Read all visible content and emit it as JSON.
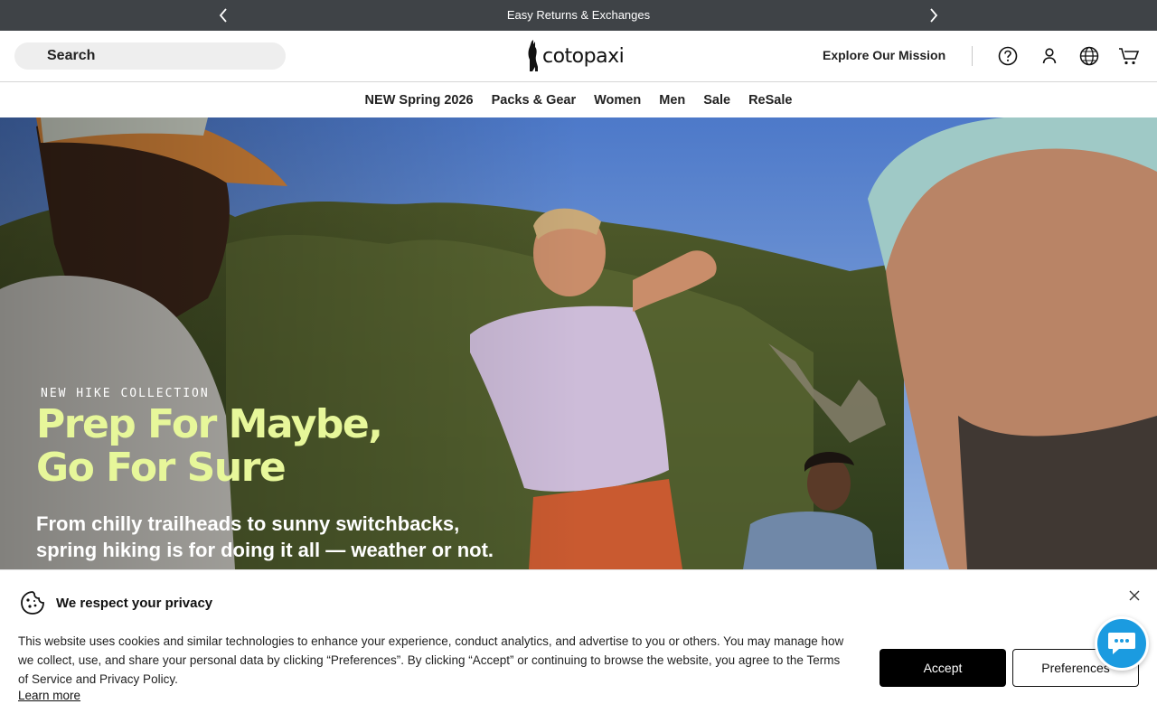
{
  "announcement": {
    "message": "Easy Returns & Exchanges",
    "prev_icon": "chevron-left-icon",
    "next_icon": "chevron-right-icon"
  },
  "header": {
    "search_label": "Search",
    "logo_text": "cotopaxi",
    "mission_link": "Explore Our Mission",
    "icons": [
      "help-icon",
      "account-icon",
      "globe-icon",
      "cart-icon"
    ]
  },
  "nav": {
    "items": [
      {
        "label": "NEW Spring 2026"
      },
      {
        "label": "Packs & Gear"
      },
      {
        "label": "Women"
      },
      {
        "label": "Men"
      },
      {
        "label": "Sale"
      },
      {
        "label": "ReSale"
      }
    ]
  },
  "hero": {
    "eyebrow": "NEW HIKE COLLECTION",
    "headline_line1": "Prep For Maybe,",
    "headline_line2": "Go For Sure",
    "subtext_line1": "From chilly trailheads to sunny switchbacks,",
    "subtext_line2": "spring hiking is for doing it all — weather or not."
  },
  "cookie_banner": {
    "title": "We respect your privacy",
    "body": "This website uses cookies and similar technologies to enhance your experience, conduct analytics, and advertise to you or others. You may manage how we collect, use, and share your personal data by clicking “Preferences”. By clicking “Accept” or continuing to browse the website, you agree to the Terms of Service and Privacy Policy.",
    "learn_more": "Learn more",
    "accept_label": "Accept",
    "preferences_label": "Preferences"
  },
  "colors": {
    "announcement_bg": "#3f4347",
    "headline": "#e7f79a",
    "chat_bubble": "#1b9be0"
  }
}
